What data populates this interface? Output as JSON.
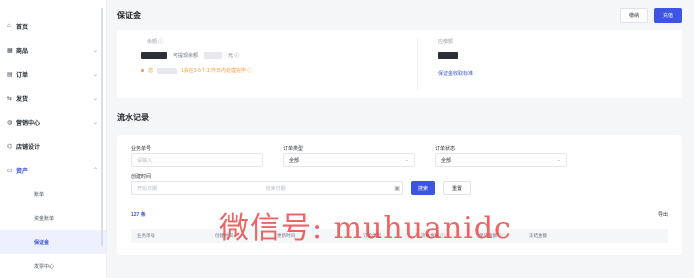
{
  "sidebar": {
    "items": [
      {
        "icon": "home-icon",
        "glyph": "⌂",
        "label": "首页",
        "chevron": ""
      },
      {
        "icon": "goods-icon",
        "glyph": "▦",
        "label": "商品",
        "chevron": "⌄"
      },
      {
        "icon": "order-icon",
        "glyph": "▤",
        "label": "订单",
        "chevron": "⌄"
      },
      {
        "icon": "shipping-icon",
        "glyph": "⇆",
        "label": "发货",
        "chevron": "⌄"
      },
      {
        "icon": "marketing-icon",
        "glyph": "◍",
        "label": "营销中心",
        "chevron": "⌄"
      },
      {
        "icon": "store-design-icon",
        "glyph": "⌬",
        "label": "店铺设计",
        "chevron": ""
      },
      {
        "icon": "assets-icon",
        "glyph": "▭",
        "label": "资产",
        "chevron": "⌃"
      }
    ],
    "sub_items": [
      "账单",
      "资金账单",
      "保证金",
      "发票中心"
    ],
    "active_sub": "保证金"
  },
  "header": {
    "title": "保证金",
    "btn_outline": "缴纳",
    "btn_primary": "充值"
  },
  "deposit": {
    "left_label": "余额 ⓘ",
    "withdrawable": "可提现余额",
    "withdraw_suffix": "元 ⓘ",
    "notice": "您",
    "notice_tail": "1会在3-5个工作日内处理完毕 ⓘ",
    "right_label": "应缴额",
    "right_link": "保证金收取标准"
  },
  "records": {
    "title": "流水记录",
    "filters": {
      "order_no_label": "业务单号",
      "order_no_placeholder": "请输入",
      "order_type_label": "订单类型",
      "order_type_value": "全部",
      "order_status_label": "订单状态",
      "order_status_value": "全部",
      "create_time_label": "创建时间",
      "start_placeholder": "开始日期",
      "end_placeholder": "结束日期",
      "search": "搜索",
      "reset": "重置"
    },
    "count": "127 条",
    "export": "导出",
    "columns": [
      "业务单号",
      "创建时间",
      "更新时间",
      "订单类型",
      "流水金额 ⓘ",
      "保证金额 ⓘ",
      "冻结金额"
    ]
  },
  "watermark": "微信号: muhuanidc",
  "colors": {
    "accent": "#3d55e0",
    "warning": "#f29b38",
    "watermark": "#e94b4b"
  }
}
